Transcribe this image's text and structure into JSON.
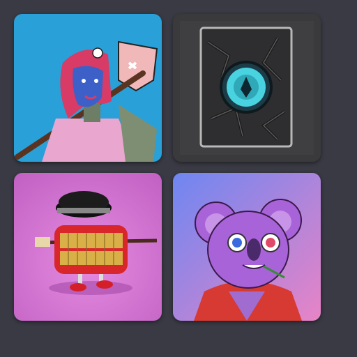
{
  "grid": {
    "items": [
      {
        "subject": "punk-warrior-axe-art",
        "bg": "#2aa0d8"
      },
      {
        "subject": "pixel-stone-card-art",
        "bg": "#3a3a3c"
      },
      {
        "subject": "chattering-teeth-art",
        "bg": "#d676d0"
      },
      {
        "subject": "purple-koala-art",
        "bg": "#8a7cf0"
      }
    ]
  },
  "colors": {
    "page_bg": "#3a3a44"
  }
}
